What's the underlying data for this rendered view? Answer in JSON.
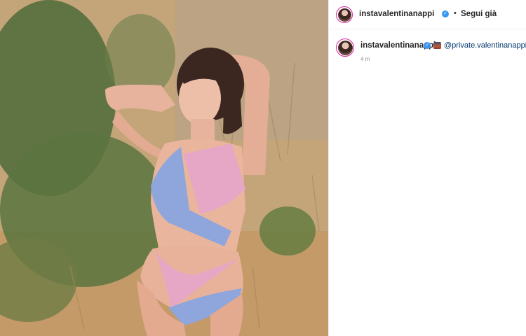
{
  "post": {
    "photo_alt_icon": "photo-image",
    "header": {
      "username": "instavalentinanappi",
      "separator": "•",
      "follow_label": "Segui già"
    },
    "caption": {
      "username": "instavalentinanappi",
      "mention": "@private.valentinanappi",
      "timestamp": "4 m"
    }
  },
  "colors": {
    "verified": "#3897f0",
    "mention": "#00376b",
    "avatar_ring": "#d6249f"
  }
}
